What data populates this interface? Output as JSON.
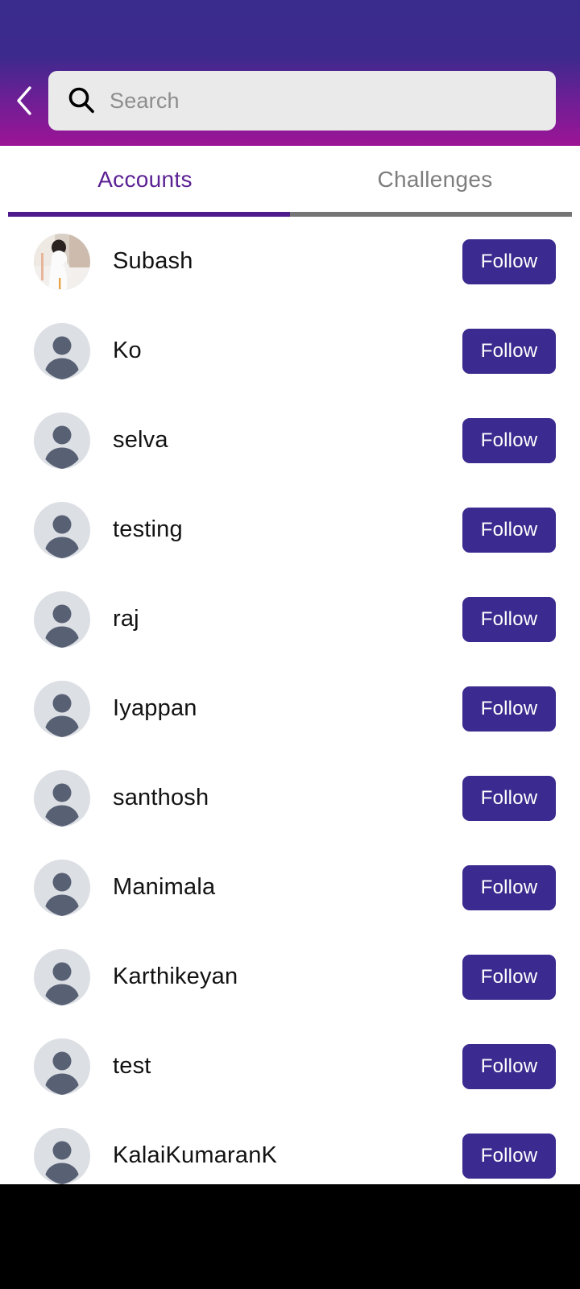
{
  "theme": {
    "gradient_top": "#3a2c8c",
    "gradient_bottom": "#9c1496",
    "accent_purple": "#4e1a8c",
    "tab_active_text": "#5b2294",
    "tab_inactive_text": "#7d7d7d",
    "follow_button_bg": "#3b2a8f",
    "search_bg": "#eaeaea",
    "avatar_bg": "#dcdfe4",
    "avatar_glyph": "#586074",
    "page_bg": "#ffffff",
    "system_bar": "#000000"
  },
  "header": {
    "back_icon": "chevron-left-icon",
    "back_label": "Back",
    "search": {
      "icon": "search-icon",
      "placeholder": "Search",
      "value": ""
    }
  },
  "tabs": [
    {
      "label": "Accounts",
      "active": true
    },
    {
      "label": "Challenges",
      "active": false
    }
  ],
  "accounts": {
    "follow_label": "Follow",
    "items": [
      {
        "name": "Subash",
        "avatar": "photo-avatar"
      },
      {
        "name": "Ko",
        "avatar": "default-person-avatar"
      },
      {
        "name": "selva",
        "avatar": "default-person-avatar"
      },
      {
        "name": "testing",
        "avatar": "default-person-avatar"
      },
      {
        "name": "raj",
        "avatar": "default-person-avatar"
      },
      {
        "name": "Iyappan",
        "avatar": "default-person-avatar"
      },
      {
        "name": "santhosh",
        "avatar": "default-person-avatar"
      },
      {
        "name": "Manimala",
        "avatar": "default-person-avatar"
      },
      {
        "name": "Karthikeyan",
        "avatar": "default-person-avatar"
      },
      {
        "name": "test",
        "avatar": "default-person-avatar"
      },
      {
        "name": "KalaiKumaranK",
        "avatar": "default-person-avatar"
      }
    ]
  }
}
